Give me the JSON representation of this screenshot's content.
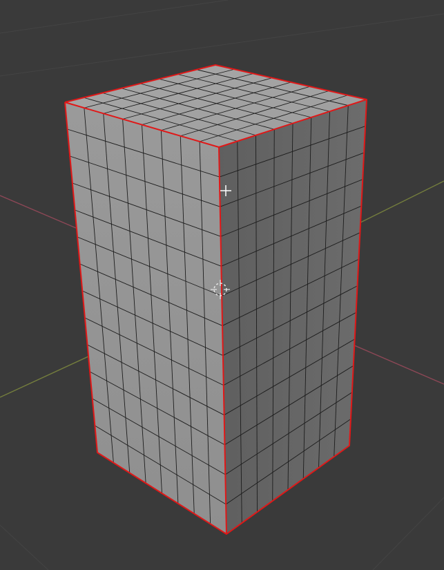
{
  "viewport": {
    "background": "#3a3a3a",
    "mode": "edit"
  },
  "axes": {
    "x_color": "#9c4a5c",
    "y_color": "#7f8a3e"
  },
  "mesh": {
    "object": "cuboid",
    "selection": "all-faces",
    "outline_color": "#e01818",
    "wire_color": "#1c1c1c",
    "face_shading": {
      "top": "#a7a7a7",
      "left": "#979797",
      "right": "#6a6a6a"
    },
    "subdivisions": {
      "top_u": 8,
      "top_v": 8,
      "left_width": 8,
      "right_width": 8,
      "height": 13
    }
  },
  "overlays": {
    "mouse_cursor": "crosshair-cursor-icon",
    "object_origin": "3d-cursor-icon"
  }
}
